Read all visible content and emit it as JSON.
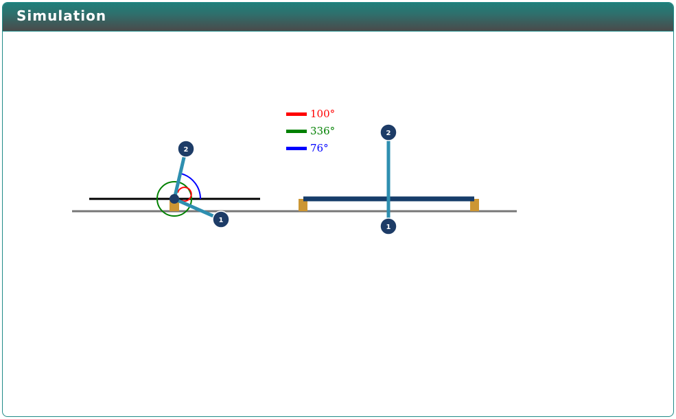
{
  "header": {
    "title": "Simulation"
  },
  "legend": [
    {
      "label": "100°",
      "color": "#ff0000"
    },
    {
      "label": "336°",
      "color": "#008000"
    },
    {
      "label": "76°",
      "color": "#0000ff"
    }
  ],
  "nodes": {
    "node1": "1",
    "node2": "2"
  },
  "colors": {
    "member": "#2e8fb0",
    "node": "#1d3c67",
    "beam": "#163c6a",
    "support": "#cc9633",
    "ground": "#777777"
  }
}
